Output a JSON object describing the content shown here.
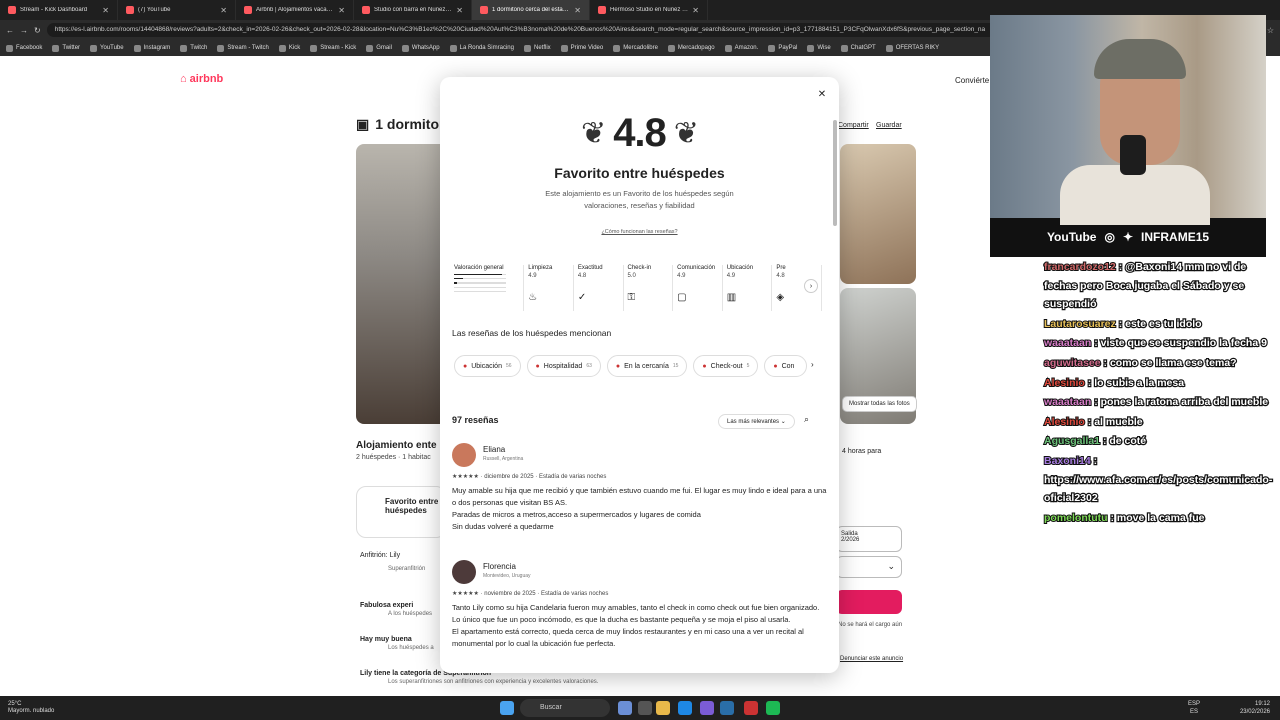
{
  "browser": {
    "tabs": [
      {
        "label": "Stream - Kick Dashboard"
      },
      {
        "label": "(7) YouTube"
      },
      {
        "label": "Airbnb | Alojamientos vacacionales"
      },
      {
        "label": "Studio con barra en Nuñez p/ 2 p"
      },
      {
        "label": "1 dormitorio cerca del estadio Riv"
      },
      {
        "label": "Hermoso Studio en Nuñez - Apart"
      }
    ],
    "url": "https://es-l.airbnb.com/rooms/14404868/reviews?adults=2&check_in=2026-02-26&check_out=2026-02-28&location=Nu%C3%B1ez%2C%20Ciudad%20Aut%C3%B3noma%20de%20Buenos%20Aires&search_mode=regular_search&source_impression_id=p3_1771884151_P3CFqOlwanXdx6fS&previous_page_section_na",
    "bookmarks": [
      "Facebook",
      "Twitter",
      "YouTube",
      "Instagram",
      "Twitch",
      "Stream - Twitch",
      "Kick",
      "Stream - Kick",
      "Gmail",
      "WhatsApp",
      "La Ronda Simracing",
      "Netflix",
      "Prime Video",
      "Mercadolibre",
      "Mercadopago",
      "Amazon.",
      "PayPal",
      "Wise",
      "ChatGPT",
      "OFERTAS RIKY"
    ]
  },
  "airbnb": {
    "logo": "airbnb",
    "host_link": "Conviérte",
    "page_title": "1 dormitori",
    "share": "Compartir",
    "save": "Guardar",
    "show_all_photos": "Mostrar todas las fotos",
    "listing_title": "Alojamiento ente",
    "listing_sub": "2 huéspedes · 1 habitac",
    "fav_box": "Favorito entre huéspedes",
    "host": "Anfitrión: Lily",
    "host_sub": "Superanfitrión",
    "features": [
      {
        "title": "Fabulosa experi",
        "sub": "A los huéspedes"
      },
      {
        "title": "Hay muy buena",
        "sub": "Los huéspedes a"
      },
      {
        "title": "Lily tiene la categoría de Superanfitrión",
        "sub": "Los superanfitriones son anfitriones con experiencia y excelentes valoraciones."
      }
    ],
    "price_text": "4 horas para",
    "date_label": "Salida",
    "date_value": "2/2026",
    "no_charge": "No se hará el cargo aún",
    "report": "Denunciar este anuncio"
  },
  "modal": {
    "rating": "4.8",
    "fav_title": "Favorito entre huéspedes",
    "fav_desc": "Este alojamiento es un Favorito de los huéspedes según valoraciones, reseñas y fiabilidad",
    "how_link": "¿Cómo funcionan las reseñas?",
    "categories": [
      {
        "label": "Valoración general",
        "value": ""
      },
      {
        "label": "Limpieza",
        "value": "4.9",
        "icon": "spray-icon"
      },
      {
        "label": "Exactitud",
        "value": "4.8",
        "icon": "check-circle-icon"
      },
      {
        "label": "Check-in",
        "value": "5.0",
        "icon": "key-icon"
      },
      {
        "label": "Comunicación",
        "value": "4.9",
        "icon": "chat-icon"
      },
      {
        "label": "Ubicación",
        "value": "4.9",
        "icon": "map-icon"
      },
      {
        "label": "Pre",
        "value": "4.8",
        "icon": "tag-icon"
      }
    ],
    "rating_bars": [
      0.92,
      0.18,
      0.05,
      0.0,
      0.0
    ],
    "mentions_title": "Las reseñas de los huéspedes mencionan",
    "chips": [
      {
        "label": "Ubicación",
        "count": "56"
      },
      {
        "label": "Hospitalidad",
        "count": "63"
      },
      {
        "label": "En la cercanía",
        "count": "15"
      },
      {
        "label": "Check-out",
        "count": "5"
      },
      {
        "label": "Con",
        "count": ""
      }
    ],
    "reviews_count": "97 reseñas",
    "sort": "Las más relevantes",
    "reviews": [
      {
        "name": "Eliana",
        "location": "Russell, Argentina",
        "stars": "★★★★★",
        "date": "diciembre de 2025 · Estadía de varias noches",
        "text": [
          "Muy amable su hija que me recibió y que también estuvo cuando me fui. El lugar es muy lindo e ideal para a una o dos personas que visitan BS AS.",
          "Paradas de micros a metros,acceso a supermercados y lugares de comida",
          "Sin dudas volveré a quedarme"
        ],
        "avatar_color": "#c9785c"
      },
      {
        "name": "Florencia",
        "location": "Montevideo, Uruguay",
        "stars": "★★★★★",
        "date": "noviembre de 2025 · Estadía de varias noches",
        "text": [
          "Tanto Lily como su hija Candelaria fueron muy amables, tanto el check in como check out fue bien organizado.",
          "Lo único que fue un poco incómodo, es que la ducha es bastante pequeña y se moja el piso al usarla.",
          "El apartamento está correcto, queda cerca de muy lindos restaurantes y en mi caso una a ver un recital al monumental por lo cual la ubicación fue perfecta."
        ],
        "avatar_color": "#4d3a3a"
      }
    ]
  },
  "stream": {
    "social": {
      "youtube": "YouTube",
      "handle": "INFRAME15"
    },
    "chat": [
      {
        "user": "francardozo12",
        "color": "#d06a6a",
        "text": "@Baxoni14 mm no vi de fechas pero Boca jugaba el Sábado y se suspendió"
      },
      {
        "user": "Lautarosuarez",
        "color": "#e8c15a",
        "text": "este es tu idolo"
      },
      {
        "user": "waaataan",
        "color": "#d67cc7",
        "text": "viste que se suspendio la fecha 9"
      },
      {
        "user": "aguwitasee",
        "color": "#d16b8c",
        "text": "como se llama ese tema?"
      },
      {
        "user": "Alesinio",
        "color": "#e24b3e",
        "text": "lo subis a la mesa"
      },
      {
        "user": "waaataan",
        "color": "#d67cc7",
        "text": "pones la ratona arriba del mueble"
      },
      {
        "user": "Alesinio",
        "color": "#e24b3e",
        "text": "al mueble"
      },
      {
        "user": "Agusgalla1",
        "color": "#6cc27a",
        "text": "de coté"
      },
      {
        "user": "Baxoni14",
        "color": "#a77de0",
        "text": "https://www.afa.com.ar/es/posts/comunicado-oficial2302"
      },
      {
        "user": "pomelontutu",
        "color": "#7ed957",
        "text": "move la cama fue"
      }
    ]
  },
  "taskbar": {
    "temp": "25°C",
    "weather": "Mayorm. nublado",
    "search": "Buscar",
    "lang": "ESP",
    "lang2": "ES",
    "time": "19:12",
    "date": "23/02/2026"
  }
}
